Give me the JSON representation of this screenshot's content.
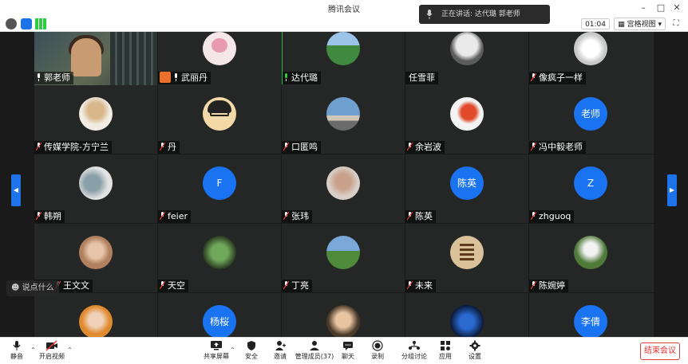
{
  "window": {
    "title": "腾讯会议"
  },
  "toast": {
    "text": "正在讲话: 达代璐 郭老师"
  },
  "toolbar": {
    "timer": "01:04",
    "view_label": "宫格视图"
  },
  "tiles": [
    {
      "name": "郭老师",
      "initials": ""
    },
    {
      "name": "武丽丹",
      "initials": ""
    },
    {
      "name": "达代璐",
      "initials": ""
    },
    {
      "name": "任雪菲",
      "initials": ""
    },
    {
      "name": "像疯子一样",
      "initials": ""
    },
    {
      "name": "传媒学院-方宁兰",
      "initials": ""
    },
    {
      "name": "丹",
      "initials": ""
    },
    {
      "name": "口匿鸣",
      "initials": ""
    },
    {
      "name": "余岩波",
      "initials": ""
    },
    {
      "name": "冯中毅老师",
      "initials": "老师"
    },
    {
      "name": "韩朔",
      "initials": ""
    },
    {
      "name": "feier",
      "initials": "F"
    },
    {
      "name": "张玮",
      "initials": ""
    },
    {
      "name": "陈英",
      "initials": "陈英"
    },
    {
      "name": "zhguoq",
      "initials": "Z"
    },
    {
      "name": "王文文",
      "initials": ""
    },
    {
      "name": "天空",
      "initials": ""
    },
    {
      "name": "丁亮",
      "initials": ""
    },
    {
      "name": "未来",
      "initials": ""
    },
    {
      "name": "陈婉婷",
      "initials": ""
    },
    {
      "name": "",
      "initials": ""
    },
    {
      "name": "",
      "initials": "杨桜"
    },
    {
      "name": "",
      "initials": ""
    },
    {
      "name": "",
      "initials": ""
    },
    {
      "name": "",
      "initials": "李倩"
    }
  ],
  "overlay": {
    "text": "说点什么"
  },
  "bottombar": {
    "mute": "静音",
    "video": "开启视频",
    "share": "共享屏幕",
    "security": "安全",
    "invite": "邀请",
    "members": "管理成员(37)",
    "chat": "聊天",
    "record": "录制",
    "breakout": "分组讨论",
    "apps": "应用",
    "settings": "设置",
    "end": "结束会议"
  },
  "colors": {
    "avatar_blue": "#1a73f0",
    "end_red": "#e03030"
  }
}
